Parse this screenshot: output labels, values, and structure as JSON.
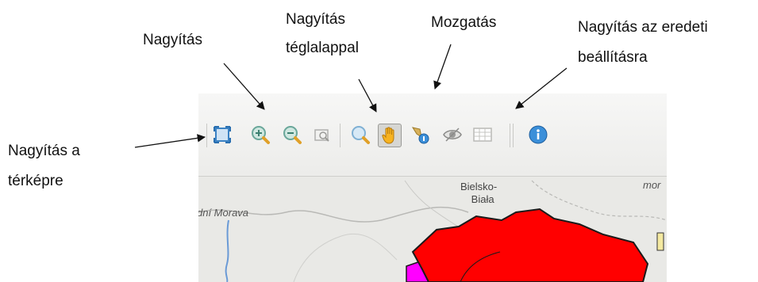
{
  "callouts": {
    "zoom": "Nagyítás",
    "zoom_rect_line1": "Nagyítás",
    "zoom_rect_line2": "téglalappal",
    "pan": "Mozgatás",
    "reset_line1": "Nagyítás az eredeti",
    "reset_line2": "beállításra",
    "extent_line1": "Nagyítás a",
    "extent_line2": "térképre"
  },
  "toolbar": {
    "icons": [
      "zoom-extent-icon",
      "zoom-in-icon",
      "zoom-out-icon",
      "zoom-previous-icon",
      "zoom-rectangle-icon",
      "pan-hand-icon",
      "identify-icon",
      "eye-icon",
      "table-icon",
      "info-icon"
    ],
    "active_tool": "pan-hand-icon"
  },
  "map": {
    "labels": {
      "city_line1": "Bielsko-",
      "city_line2": "Biała",
      "river": "dní Morava",
      "corner": "mor"
    },
    "colors": {
      "region_fill": "#ff0000",
      "region_border": "#1a1a1a",
      "magenta_region": "#ff00ff",
      "background": "#e9e9e6",
      "river": "#6a9ad6"
    }
  }
}
